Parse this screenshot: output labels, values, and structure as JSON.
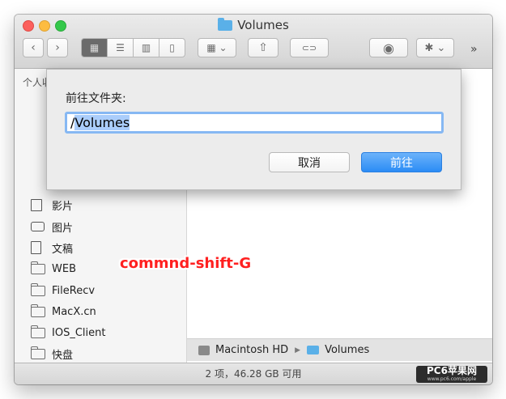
{
  "window": {
    "title": "Volumes",
    "title_icon": "folder-icon"
  },
  "toolbar": {
    "back": "‹",
    "forward": "›",
    "view_icons": "▦",
    "view_list": "☰",
    "view_columns": "▥",
    "view_cover": "▯",
    "arrange": "▦ ⌄",
    "share": "⇧",
    "tag": "⊂⊃",
    "quicklook": "◉",
    "action": "✱ ⌄",
    "overflow": "»"
  },
  "sidebar": {
    "header": "个人收",
    "items": [
      {
        "label": "影片",
        "icon": "film-icon"
      },
      {
        "label": "图片",
        "icon": "camera-icon"
      },
      {
        "label": "文稿",
        "icon": "document-icon"
      },
      {
        "label": "WEB",
        "icon": "folder-icon"
      },
      {
        "label": "FileRecv",
        "icon": "folder-icon"
      },
      {
        "label": "MacX.cn",
        "icon": "folder-icon"
      },
      {
        "label": "IOS_Client",
        "icon": "folder-icon"
      },
      {
        "label": "快盘",
        "icon": "folder-icon"
      }
    ]
  },
  "pathbar": {
    "disk": "Macintosh HD",
    "folder": "Volumes"
  },
  "statusbar": {
    "text": "2 项，46.28 GB 可用",
    "watermark_main": "PC6苹果网",
    "watermark_sub": "www.pc6.com/apple"
  },
  "sheet": {
    "label": "前往文件夹:",
    "input_prefix": "/",
    "input_selected": "Volumes",
    "cancel_label": "取消",
    "go_label": "前往"
  },
  "annotation": "commnd-shift-G"
}
